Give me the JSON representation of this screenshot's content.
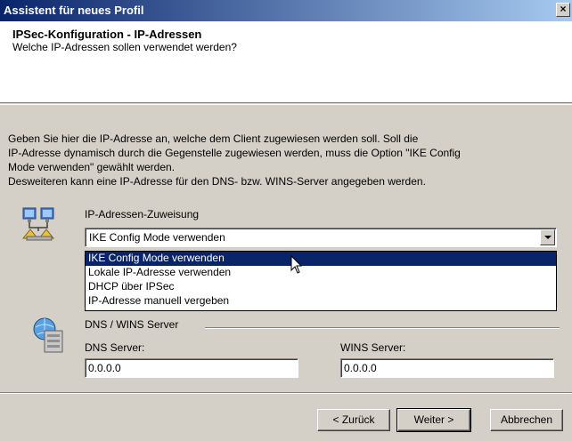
{
  "window": {
    "title": "Assistent für neues Profil",
    "close_label": "×"
  },
  "header": {
    "title": "IPSec-Konfiguration - IP-Adressen",
    "subtitle": "Welche IP-Adressen sollen verwendet werden?"
  },
  "description": [
    "Geben Sie hier die IP-Adresse an, welche dem Client zugewiesen werden soll. Soll die",
    "IP-Adresse dynamisch durch die Gegenstelle zugewiesen werden, muss die Option \"IKE Config",
    "Mode verwenden\" gewählt werden.",
    "Desweiteren kann eine IP-Adresse für den DNS- bzw. WINS-Server angegeben werden."
  ],
  "assignment": {
    "label": "IP-Adressen-Zuweisung",
    "selected": "IKE Config Mode verwenden",
    "options": [
      "IKE Config Mode verwenden",
      "Lokale IP-Adresse verwenden",
      "DHCP über IPSec",
      "IP-Adresse manuell vergeben"
    ]
  },
  "dns_wins": {
    "group_label": "DNS / WINS Server",
    "dns_label": "DNS Server:",
    "dns_value": "0.0.0.0",
    "wins_label": "WINS Server:",
    "wins_value": "0.0.0.0"
  },
  "buttons": {
    "back": "< Zurück",
    "next": "Weiter >",
    "cancel": "Abbrechen"
  }
}
